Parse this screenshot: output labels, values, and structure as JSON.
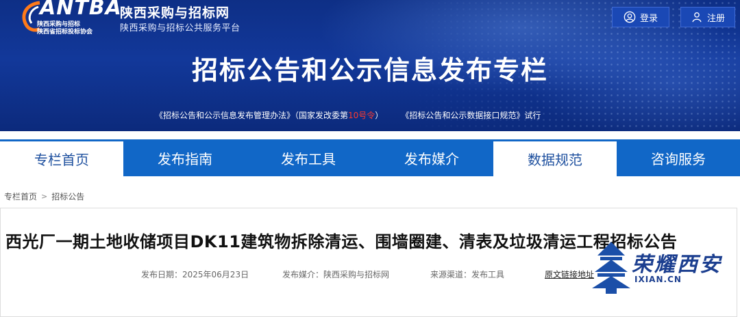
{
  "header": {
    "logo_text": "ANTBA",
    "logo_sub1": "陕西采购与招标",
    "logo_sub2": "陕西省招标投标协会",
    "site_name": "陕西采购与招标网",
    "site_subtitle": "陕西采购与招标公共服务平台",
    "login_label": "登录",
    "register_label": "注册",
    "banner_title": "招标公告和公示信息发布专栏",
    "notice_part1": "《招标公告和公示信息发布管理办法》（国家发改委第",
    "notice_red": "10号令",
    "notice_part2": "）",
    "notice_part3": "《招标公告和公示数据接口规范》试行",
    "colors": {
      "banner": "#12389a",
      "notice_red": "#ff3a2e"
    }
  },
  "nav": {
    "tabs": [
      {
        "label": "专栏首页"
      },
      {
        "label": "发布指南"
      },
      {
        "label": "发布工具"
      },
      {
        "label": "发布媒介"
      },
      {
        "label": "数据规范"
      },
      {
        "label": "咨询服务"
      }
    ],
    "colors": {
      "tab_blue": "#1167c7",
      "tab_light_text": "#1d4f9e"
    }
  },
  "breadcrumb": {
    "home": "专栏首页",
    "separator": ">",
    "current": "招标公告"
  },
  "article": {
    "title": "西光厂一期土地收储项目DK11建筑物拆除清运、围墙圈建、清表及垃圾清运工程招标公告",
    "date": "发布日期：2025年06月23日",
    "media": "发布媒介：陕西采购与招标网",
    "source": "来源渠道：发布工具",
    "link": "原文链接地址"
  },
  "watermark": {
    "text": "荣耀西安",
    "url": "IXIAN.CN"
  }
}
